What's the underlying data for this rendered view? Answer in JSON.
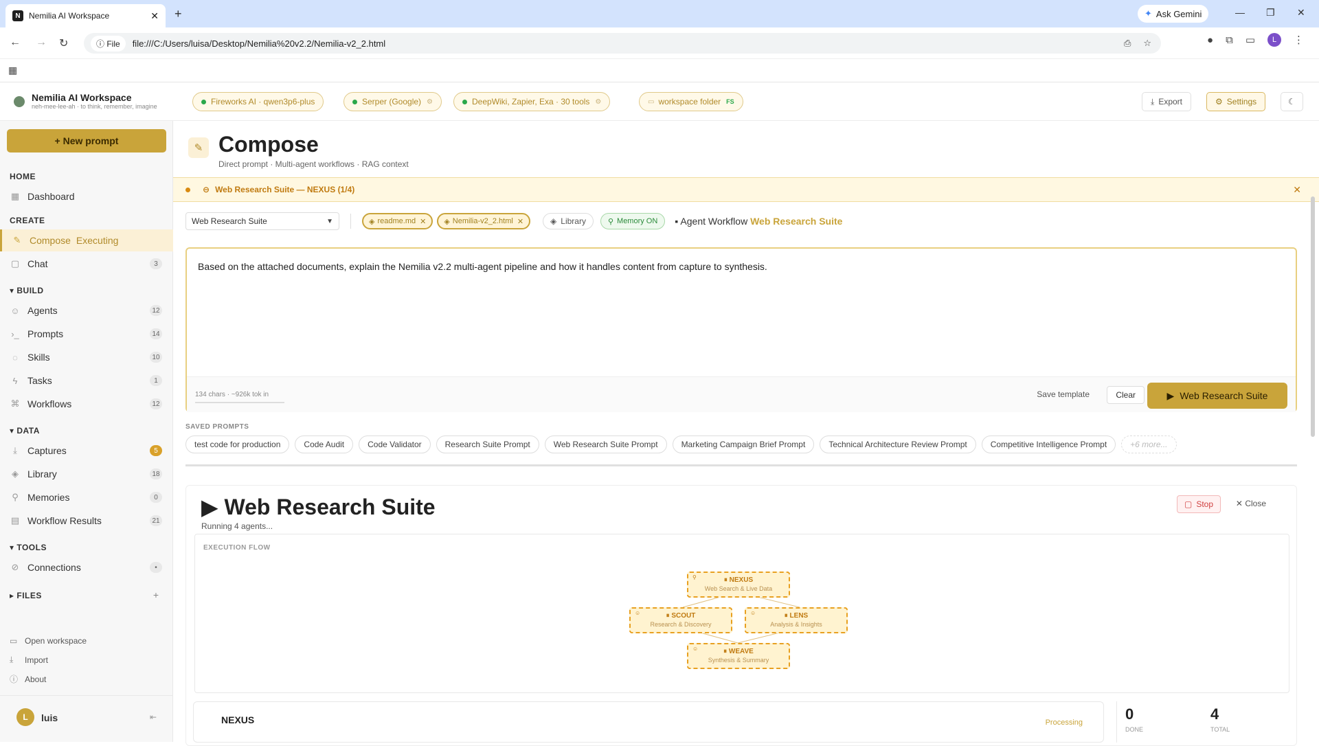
{
  "browser": {
    "tab_title": "Nemilia AI Workspace",
    "tab_favicon": "N",
    "new_tab": "+",
    "ask_gemini": "Ask Gemini",
    "url_chip": "File",
    "url": "file:///C:/Users/luisa/Desktop/Nemilia%20v2.2/Nemilia-v2_2.html",
    "profile_initial": "L"
  },
  "topbar": {
    "brand_title": "Nemilia AI Workspace",
    "brand_sub": "neh-mee-lee-ah · to think, remember, imagine",
    "pills": [
      {
        "label": "Fireworks AI · qwen3p6-plus",
        "status": "green"
      },
      {
        "label": "Serper (Google)",
        "status": "green"
      },
      {
        "label": "DeepWiki, Zapier, Exa · 30 tools",
        "status": "green"
      }
    ],
    "folder_label": "workspace folder",
    "folder_badge": "FS",
    "export_label": "Export",
    "settings_label": "Settings"
  },
  "sidebar": {
    "new_prompt": "+ New prompt",
    "home_header": "HOME",
    "dashboard": "Dashboard",
    "create_header": "CREATE",
    "compose": "Compose",
    "compose_status": "Executing",
    "chat": "Chat",
    "chat_count": "3",
    "build_header": "BUILD",
    "build_items": [
      {
        "label": "Agents",
        "count": "12",
        "icon": "agent-icon",
        "glyph": "☺"
      },
      {
        "label": "Prompts",
        "count": "14",
        "icon": "prompt-icon",
        "glyph": "›_"
      },
      {
        "label": "Skills",
        "count": "10",
        "icon": "bulb-icon",
        "glyph": "◌"
      },
      {
        "label": "Tasks",
        "count": "1",
        "icon": "bolt-icon",
        "glyph": "ϟ"
      },
      {
        "label": "Workflows",
        "count": "12",
        "icon": "workflow-icon",
        "glyph": "⌘"
      }
    ],
    "data_header": "DATA",
    "data_items": [
      {
        "label": "Captures",
        "count": "5",
        "icon": "capture-icon",
        "glyph": "⤓",
        "hot": true
      },
      {
        "label": "Library",
        "count": "18",
        "icon": "library-icon",
        "glyph": "◈",
        "hot": false
      },
      {
        "label": "Memories",
        "count": "0",
        "icon": "memory-icon",
        "glyph": "⚲",
        "hot": false
      },
      {
        "label": "Workflow Results",
        "count": "21",
        "icon": "results-icon",
        "glyph": "▤",
        "hot": false
      }
    ],
    "tools_header": "TOOLS",
    "connections": "Connections",
    "connections_count": "•",
    "files_header": "FILES",
    "files_add": "+",
    "open_workspace": "Open workspace",
    "import": "Import",
    "about": "About",
    "user_initial": "L",
    "user_name": "luis"
  },
  "main": {
    "title": "Compose",
    "subtitle": "Direct prompt · Multi-agent workflows · RAG context",
    "banner": "Web Research Suite — NEXUS (1/4)",
    "workflow_select": "Web Research Suite",
    "files": [
      "readme.md",
      "Nemilia-v2_2.html"
    ],
    "library_label": "Library",
    "memory_label": "Memory ON",
    "agent_workflow_label": "Agent Workflow",
    "agent_workflow_name": "Web Research Suite",
    "prompt_text": "Based on the attached documents, explain the Nemilia v2.2 multi-agent pipeline and how it handles content from capture to synthesis.",
    "char_count": "134 chars · ~926k tok in",
    "save_template": "Save template",
    "clear": "Clear",
    "run_label": "Web Research Suite",
    "saved_header": "SAVED PROMPTS",
    "saved_prompts": [
      "test code for production",
      "Code Audit",
      "Code Validator",
      "Research Suite Prompt",
      "Web Research Suite Prompt",
      "Marketing Campaign Brief Prompt",
      "Technical Architecture Review Prompt",
      "Competitive Intelligence Prompt"
    ],
    "saved_more": "+6 more..."
  },
  "run": {
    "title": "Web Research Suite",
    "subtitle": "Running 4 agents...",
    "stop": "Stop",
    "close": "Close",
    "flow_header": "EXECUTION FLOW",
    "nodes": [
      {
        "name": "NEXUS",
        "desc": "Web Search & Live Data"
      },
      {
        "name": "SCOUT",
        "desc": "Research & Discovery"
      },
      {
        "name": "LENS",
        "desc": "Analysis & Insights"
      },
      {
        "name": "WEAVE",
        "desc": "Synthesis & Summary"
      }
    ],
    "current_agent": "NEXUS",
    "current_status": "Processing",
    "done_value": "0",
    "done_label": "DONE",
    "total_value": "4",
    "total_label": "TOTAL"
  },
  "colors": {
    "accent": "#c9a43a",
    "status_green": "#2aa84a",
    "banner_text": "#c07a10",
    "stop_red": "#d04040"
  }
}
